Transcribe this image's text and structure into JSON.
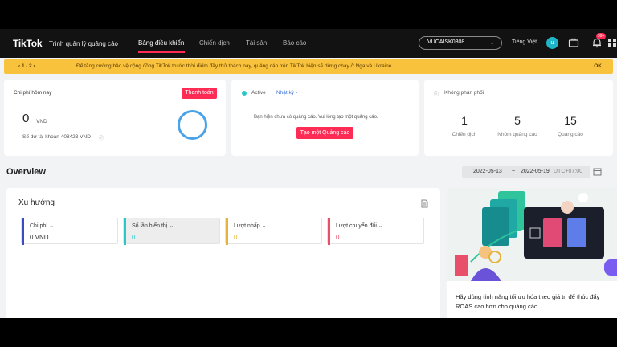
{
  "nav": {
    "logo": "TikTok",
    "logo_sub": "Trình quản lý quảng cáo",
    "items": [
      "Bảng điều khiển",
      "Chiến dịch",
      "Tài sản",
      "Báo cáo"
    ],
    "account": "VUCAISK0308",
    "language": "Tiếng Việt",
    "avatar_letter": "u",
    "notif_badge": "99+"
  },
  "banner": {
    "pager": "‹  1 / 2  ›",
    "message": "Để tăng cường bảo vệ cộng đồng TikTok trước thời điểm đầy thử thách này, quảng cáo trên TikTok hiện sẽ dừng chạy ở Nga và Ukraine.",
    "ok": "OK",
    "color": "#f9c23c"
  },
  "cost_card": {
    "title": "Chi phí hôm nay",
    "pay_button": "Thanh toán",
    "value": "0",
    "unit": "VND",
    "balance": "Số dư tài khoản 408423 VND"
  },
  "status_card": {
    "status": "Active",
    "log_link": "Nhật ký ›",
    "empty_msg": "Bạn hiện chưa có quảng cáo. Vui lòng tạo một quảng cáo.",
    "create_button": "Tạo một Quảng cáo"
  },
  "delivery_card": {
    "title": "Không phân phối",
    "stats": [
      {
        "value": "1",
        "label": "Chiến dịch"
      },
      {
        "value": "5",
        "label": "Nhóm quảng cáo"
      },
      {
        "value": "15",
        "label": "Quảng cáo"
      }
    ]
  },
  "overview": {
    "title": "Overview",
    "date_start": "2022-05-13",
    "date_sep": "~",
    "date_end": "2022-05-19",
    "timezone": "UTC+07:00"
  },
  "trend": {
    "title": "Xu hướng",
    "metrics": [
      {
        "label": "Chi phí",
        "value": "0 VND",
        "color": "#3b4cc0"
      },
      {
        "label": "Số lần hiển thị",
        "value": "0",
        "color": "#2ec7c9"
      },
      {
        "label": "Lượt nhấp",
        "value": "0",
        "color": "#e6b33c"
      },
      {
        "label": "Lượt chuyển đổi",
        "value": "0",
        "color": "#e8506a"
      }
    ]
  },
  "promo": {
    "caption": "Hãy dùng tính năng tối ưu hóa theo giá trị để thúc đẩy ROAS cao hơn cho quảng cáo"
  },
  "icons": {
    "info": "info-icon",
    "export": "document-icon",
    "calendar": "calendar-icon",
    "briefcase": "briefcase-icon",
    "bell": "bell-icon",
    "grid": "apps-icon"
  }
}
